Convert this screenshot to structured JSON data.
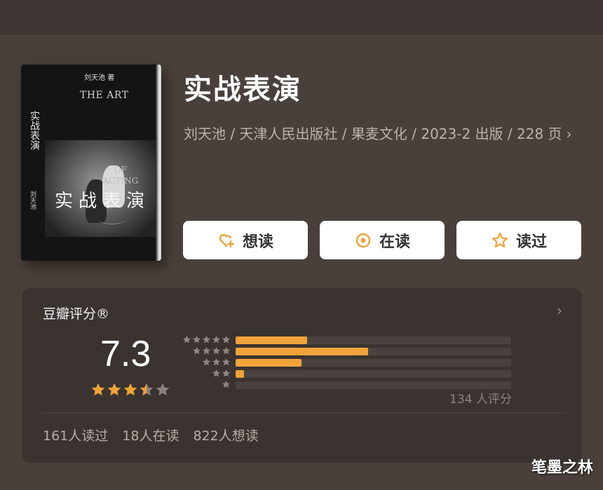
{
  "book": {
    "title": "实战表演",
    "meta": "刘天池 / 天津人民出版社 / 果麦文化 / 2023-2 出版 / 228 页",
    "meta_chevron": "›",
    "cover": {
      "author_small": "刘天池 著",
      "english_title": "THE ART",
      "english_title_2": "OF ACTING",
      "vertical_title": "实战表演",
      "vertical_author": "刘天池",
      "chinese_title": "实战表演"
    }
  },
  "actions": {
    "want": {
      "label": "想读",
      "icon": "heart-plus-icon"
    },
    "reading": {
      "label": "在读",
      "icon": "circle-dot-icon"
    },
    "read": {
      "label": "读过",
      "icon": "star-outline-icon"
    }
  },
  "rating": {
    "title": "豆瓣评分®",
    "chevron": "›",
    "score": "7.3",
    "star_value": 3.5,
    "star_max": 5,
    "distribution": [
      {
        "stars": 5,
        "fraction": 0.26
      },
      {
        "stars": 4,
        "fraction": 0.48
      },
      {
        "stars": 3,
        "fraction": 0.24
      },
      {
        "stars": 2,
        "fraction": 0.03
      },
      {
        "stars": 1,
        "fraction": 0.0
      }
    ],
    "count_text": "134 人评分"
  },
  "stats": {
    "read": "161人读过",
    "reading": "18人在读",
    "want": "822人想读"
  },
  "watermark": "笔墨之林",
  "colors": {
    "accent": "#f0a33a",
    "star_off": "#8a827d",
    "background": "#4a403b",
    "card": "#3a3330"
  }
}
